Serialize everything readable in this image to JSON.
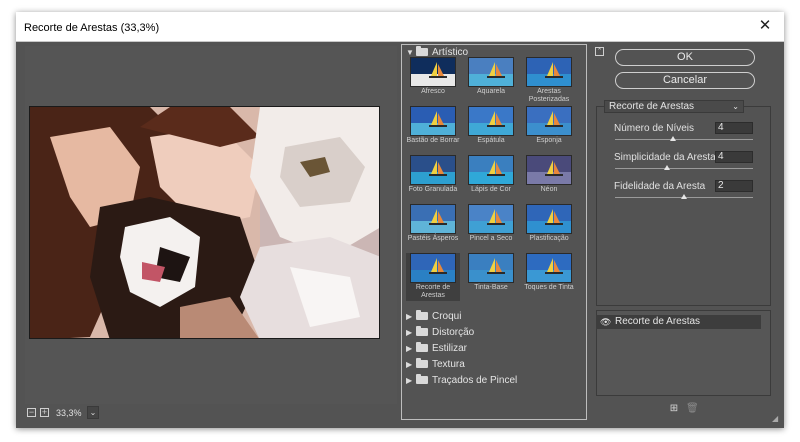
{
  "window": {
    "title": "Recorte de Arestas (33,3%)"
  },
  "zoom": {
    "value": "33,3%",
    "minus": "−",
    "plus": "+"
  },
  "gallery": {
    "artistic_group": "Artístico",
    "filters": [
      {
        "label": "Afresco"
      },
      {
        "label": "Aquarela"
      },
      {
        "label": "Arestas Posterizadas"
      },
      {
        "label": "Bastão de Borrar"
      },
      {
        "label": "Espátula"
      },
      {
        "label": "Esponja"
      },
      {
        "label": "Foto Granulada"
      },
      {
        "label": "Lápis de Cor"
      },
      {
        "label": "Néon"
      },
      {
        "label": "Pastéis Ásperos"
      },
      {
        "label": "Pincel a Seco"
      },
      {
        "label": "Plastificação"
      },
      {
        "label": "Recorte de Arestas"
      },
      {
        "label": "Tinta-Base"
      },
      {
        "label": "Toques de Tinta"
      }
    ],
    "selected_filter": "Recorte de Arestas",
    "collapsed_groups": [
      "Croqui",
      "Distorção",
      "Estilizar",
      "Textura",
      "Traçados de Pincel"
    ]
  },
  "buttons": {
    "ok": "OK",
    "cancel": "Cancelar"
  },
  "settings": {
    "filter_select": "Recorte de Arestas",
    "params": [
      {
        "label": "Número de Níveis",
        "value": "4",
        "level": 0.42
      },
      {
        "label": "Simplicidade da Aresta",
        "value": "4",
        "level": 0.38
      },
      {
        "label": "Fidelidade da Aresta",
        "value": "2",
        "level": 0.5
      }
    ]
  },
  "layers": {
    "active": "Recorte de Arestas"
  }
}
